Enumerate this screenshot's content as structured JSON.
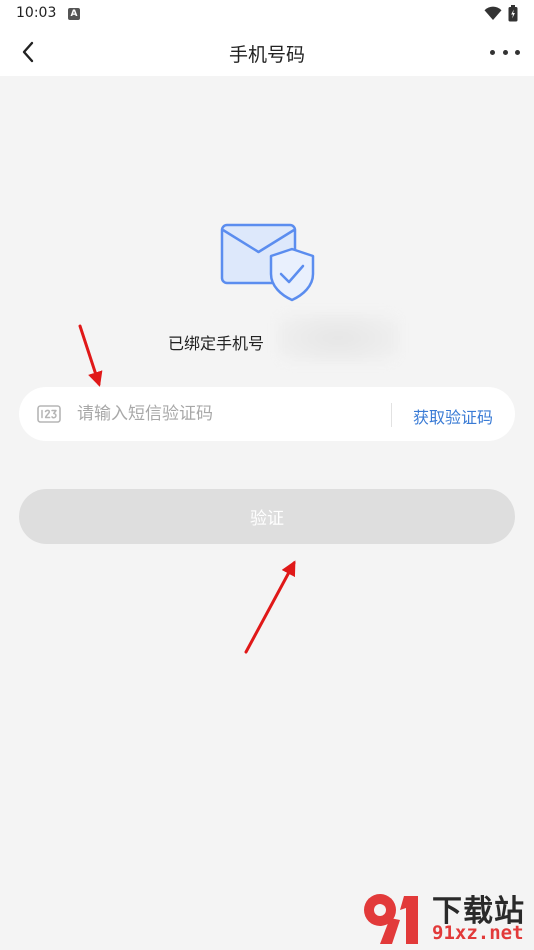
{
  "status_bar": {
    "time": "10:03",
    "app_icon_letter": "A",
    "icons": [
      "wifi-icon",
      "battery-icon"
    ]
  },
  "nav": {
    "back_icon": "chevron-left-icon",
    "title": "手机号码",
    "more_icon": "more-horizontal-icon"
  },
  "illustration": {
    "icons": [
      "envelope-icon",
      "shield-check-icon"
    ],
    "accent_color": "#5b8def",
    "fill_color": "#dde8fb"
  },
  "bound": {
    "label": "已绑定手机号"
  },
  "code_input": {
    "icon": "keypad-123-icon",
    "placeholder": "请输入短信验证码",
    "value": ""
  },
  "get_code": {
    "label": "获取验证码",
    "color": "#3a7bd5"
  },
  "verify": {
    "label": "验证",
    "bg_color": "#dedede"
  },
  "annotations": {
    "arrow_color": "#e01818",
    "arrows": [
      "arrow-to-code-input",
      "arrow-to-verify-button"
    ]
  },
  "watermark": {
    "title": "下载站",
    "domain": "91xz.net",
    "logo": "91-logo"
  }
}
